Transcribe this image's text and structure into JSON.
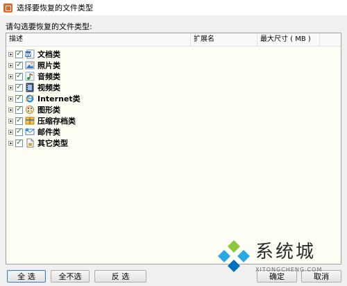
{
  "window": {
    "title": "选择要恢复的文件类型",
    "icon": "app-logo-icon"
  },
  "prompt": "请勾选要恢复的文件类型:",
  "columns": [
    "描述",
    "扩展名",
    "最大尺寸 ( MB )",
    ""
  ],
  "categories": [
    {
      "label": "文档类",
      "icon": "word-document-icon",
      "checked": true
    },
    {
      "label": "照片类",
      "icon": "photo-icon",
      "checked": true
    },
    {
      "label": "音频类",
      "icon": "audio-icon",
      "checked": true
    },
    {
      "label": "视频类",
      "icon": "video-icon",
      "checked": true
    },
    {
      "label": "Internet类",
      "icon": "internet-explorer-icon",
      "checked": true
    },
    {
      "label": "图形类",
      "icon": "graphics-icon",
      "checked": true
    },
    {
      "label": "压缩存档类",
      "icon": "archive-icon",
      "checked": true
    },
    {
      "label": "邮件类",
      "icon": "mail-icon",
      "checked": true
    },
    {
      "label": "其它类型",
      "icon": "other-file-icon",
      "checked": true
    }
  ],
  "buttons": {
    "select_all": "全  选",
    "select_none": "全不选",
    "invert": "反  选",
    "ok": "确定",
    "cancel": "取消"
  },
  "watermark": {
    "text": "系统城",
    "sub": "XITONGCHENG.COM"
  },
  "colors": {
    "list_bg": "#fffef5",
    "check": "#1e7c1e",
    "accent": "#3c7fb1"
  }
}
